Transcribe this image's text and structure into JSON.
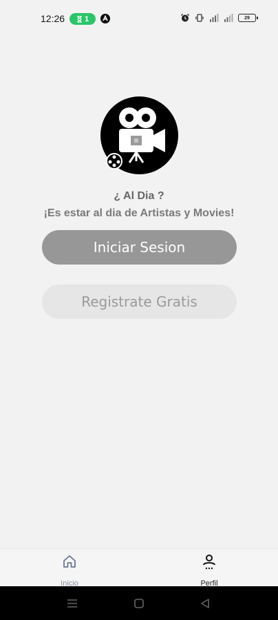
{
  "status_bar": {
    "time": "12:26",
    "pill_count": "1",
    "battery_level": "29",
    "accent_green": "#2bc46a"
  },
  "logo": {
    "icon": "movie-camera-icon",
    "background": "#000000"
  },
  "tagline": {
    "title": "¿ Al Dia ?",
    "subtitle": "¡Es estar al dia de Artistas y Movies!"
  },
  "actions": {
    "login_label": "Iniciar Sesion",
    "register_label": "Registrate Gratis"
  },
  "bottom_nav": {
    "items": [
      {
        "label": "Inicio",
        "icon": "home-icon",
        "active": false
      },
      {
        "label": "Perfil",
        "icon": "profile-icon",
        "active": true
      }
    ]
  },
  "system_nav": {
    "buttons": [
      "menu-icon",
      "home-square-icon",
      "back-triangle-icon"
    ]
  }
}
